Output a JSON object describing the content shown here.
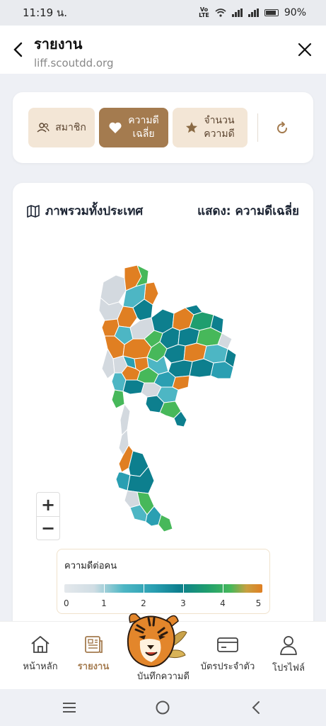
{
  "status_bar": {
    "time": "11:19 น.",
    "network": "VoLTE2",
    "battery": "90%"
  },
  "header": {
    "title": "รายงาน",
    "url": "liff.scoutdd.org"
  },
  "tabs": [
    {
      "label": "สมาชิก",
      "icon": "users-icon",
      "active": false
    },
    {
      "label": "ความดี\nเฉลี่ย",
      "icon": "heart-icon",
      "active": true
    },
    {
      "label": "จำนวน\nความดี",
      "icon": "star-icon",
      "active": false
    }
  ],
  "map_card": {
    "title": "ภาพรวมทั้งประเทศ",
    "display_label": "แสดง: ความดีเฉลี่ย"
  },
  "map_colors": {
    "none": "#d3d9df",
    "teal_light": "#4db6c4",
    "teal": "#2a9fb2",
    "teal_dark": "#0d7f8e",
    "green": "#1f9e6e",
    "green_light": "#47b85a",
    "orange": "#e07f22"
  },
  "zoom": {
    "in": "+",
    "out": "−"
  },
  "legend": {
    "title": "ความดีต่อคน",
    "labels": [
      "0",
      "1",
      "2",
      "3",
      "4",
      "5"
    ]
  },
  "bottom_nav": {
    "home": "หน้าหลัก",
    "report": "รายงาน",
    "record": "บันทึกความดี",
    "card": "บัตรประจำตัว",
    "profile": "โปรไฟล์"
  },
  "accent_color": "#a47b4f"
}
